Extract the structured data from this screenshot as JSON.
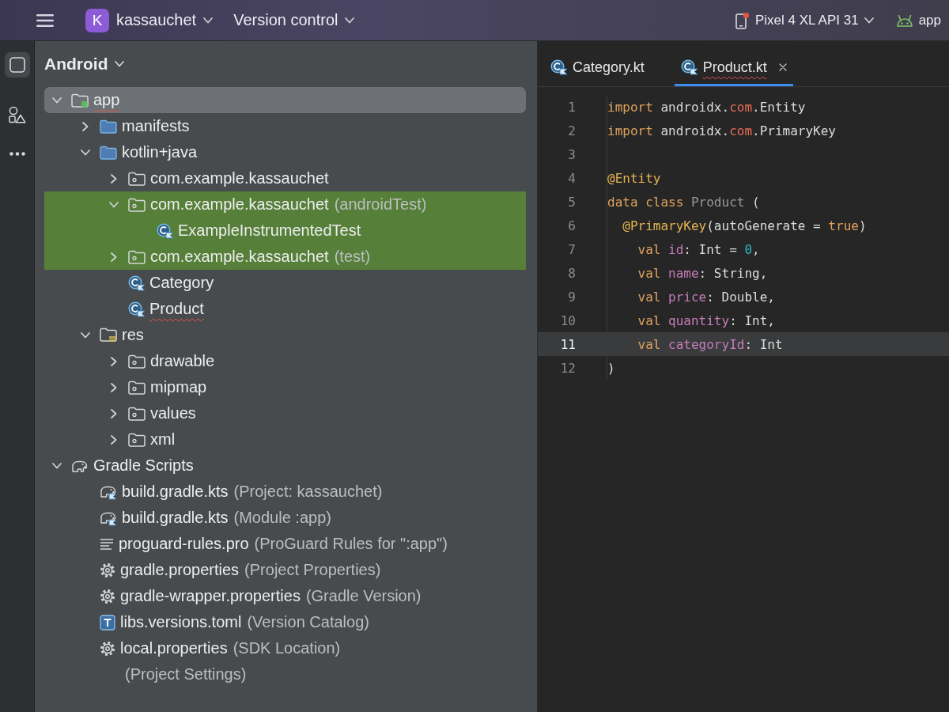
{
  "title_bar": {
    "project_badge": "K",
    "project": "kassauchet",
    "vcs": "Version control",
    "device": "Pixel 4 XL API 31",
    "run_config": "app"
  },
  "project_panel": {
    "view": "Android",
    "tree": [
      {
        "label": "app",
        "kind": "module",
        "expanded": true,
        "selected": true,
        "test": false,
        "error": true,
        "children": [
          {
            "label": "manifests",
            "kind": "folder",
            "expanded": false,
            "selected": false,
            "test": false,
            "error": false
          },
          {
            "label": "kotlin+java",
            "kind": "folder",
            "expanded": true,
            "selected": false,
            "test": false,
            "error": false,
            "children": [
              {
                "label": "com.example.kassauchet",
                "kind": "package",
                "expanded": false,
                "selected": false,
                "test": false,
                "error": false
              },
              {
                "label": "com.example.kassauchet",
                "hint": "(androidTest)",
                "kind": "package",
                "expanded": true,
                "selected": false,
                "test": true,
                "error": false,
                "children": [
                  {
                    "label": "ExampleInstrumentedTest",
                    "kind": "kotlin-class",
                    "selected": false,
                    "test": true,
                    "error": false
                  }
                ]
              },
              {
                "label": "com.example.kassauchet",
                "hint": "(test)",
                "kind": "package",
                "expanded": false,
                "selected": false,
                "test": true,
                "error": false
              },
              {
                "label": "Category",
                "kind": "kotlin-class",
                "selected": false,
                "test": false,
                "error": false
              },
              {
                "label": "Product",
                "kind": "kotlin-class",
                "selected": false,
                "test": false,
                "error": true
              }
            ]
          },
          {
            "label": "res",
            "kind": "res-folder",
            "expanded": true,
            "selected": false,
            "test": false,
            "error": false,
            "children": [
              {
                "label": "drawable",
                "kind": "directory",
                "expanded": false,
                "selected": false,
                "test": false,
                "error": false
              },
              {
                "label": "mipmap",
                "kind": "directory",
                "expanded": false,
                "selected": false,
                "test": false,
                "error": false
              },
              {
                "label": "values",
                "kind": "directory",
                "expanded": false,
                "selected": false,
                "test": false,
                "error": false
              },
              {
                "label": "xml",
                "kind": "directory",
                "expanded": false,
                "selected": false,
                "test": false,
                "error": false
              }
            ]
          }
        ]
      },
      {
        "label": "Gradle Scripts",
        "kind": "gradle",
        "expanded": true,
        "selected": false,
        "test": false,
        "error": false,
        "children": [
          {
            "label": "build.gradle.kts",
            "hint": "(Project: kassauchet)",
            "kind": "gradle-script",
            "selected": false,
            "test": false,
            "error": false
          },
          {
            "label": "build.gradle.kts",
            "hint": "(Module :app)",
            "kind": "gradle-script",
            "selected": false,
            "test": false,
            "error": false
          },
          {
            "label": "proguard-rules.pro",
            "hint": "(ProGuard Rules for \":app\")",
            "kind": "text",
            "selected": false,
            "test": false,
            "error": false
          },
          {
            "label": "gradle.properties",
            "hint": "(Project Properties)",
            "kind": "properties",
            "selected": false,
            "test": false,
            "error": false
          },
          {
            "label": "gradle-wrapper.properties",
            "hint": "(Gradle Version)",
            "kind": "properties",
            "selected": false,
            "test": false,
            "error": false
          },
          {
            "label": "libs.versions.toml",
            "hint": "(Version Catalog)",
            "kind": "toml",
            "selected": false,
            "test": false,
            "error": false
          },
          {
            "label": "local.properties",
            "hint": "(SDK Location)",
            "kind": "properties",
            "selected": false,
            "test": false,
            "error": false
          },
          {
            "hint": "(Project Settings)",
            "selected": false,
            "test": false
          }
        ]
      }
    ]
  },
  "editor": {
    "tabs": [
      {
        "label": "Category.kt",
        "selected": false,
        "error": false
      },
      {
        "label": "Product.kt",
        "selected": true,
        "error": true
      }
    ],
    "lines": [
      {
        "number": "1",
        "current": false,
        "tokens": [
          {
            "kind": "keyword",
            "text": "import"
          },
          {
            "kind": "plain",
            "text": " androidx."
          },
          {
            "kind": "error",
            "text": "com"
          },
          {
            "kind": "plain",
            "text": ".Entity"
          }
        ]
      },
      {
        "number": "2",
        "current": false,
        "tokens": [
          {
            "kind": "keyword",
            "text": "import"
          },
          {
            "kind": "plain",
            "text": " androidx."
          },
          {
            "kind": "error",
            "text": "com"
          },
          {
            "kind": "plain",
            "text": ".PrimaryKey"
          }
        ]
      },
      {
        "number": "3",
        "current": false
      },
      {
        "number": "4",
        "current": false,
        "tokens": [
          {
            "kind": "annotation",
            "text": "@Entity"
          }
        ]
      },
      {
        "number": "5",
        "current": false,
        "tokens": [
          {
            "kind": "keyword",
            "text": "data class"
          },
          {
            "kind": "unused",
            "text": " Product"
          },
          {
            "kind": "plain",
            "text": " ("
          }
        ]
      },
      {
        "number": "6",
        "current": false,
        "tokens": [
          {
            "kind": "annotation",
            "text": "  @PrimaryKey"
          },
          {
            "kind": "plain",
            "text": "(autoGenerate = "
          },
          {
            "kind": "keyword",
            "text": "true"
          },
          {
            "kind": "plain",
            "text": ")"
          }
        ]
      },
      {
        "number": "7",
        "current": false,
        "tokens": [
          {
            "kind": "keyword",
            "text": "    val "
          },
          {
            "kind": "property",
            "text": "id"
          },
          {
            "kind": "plain",
            "text": ": Int = "
          },
          {
            "kind": "number",
            "text": "0"
          },
          {
            "kind": "plain",
            "text": ","
          }
        ]
      },
      {
        "number": "8",
        "current": false,
        "tokens": [
          {
            "kind": "keyword",
            "text": "    val "
          },
          {
            "kind": "property",
            "text": "name"
          },
          {
            "kind": "plain",
            "text": ": String,"
          }
        ]
      },
      {
        "number": "9",
        "current": false,
        "tokens": [
          {
            "kind": "keyword",
            "text": "    val "
          },
          {
            "kind": "property",
            "text": "price"
          },
          {
            "kind": "plain",
            "text": ": Double,"
          }
        ]
      },
      {
        "number": "10",
        "current": false,
        "tokens": [
          {
            "kind": "keyword",
            "text": "    val "
          },
          {
            "kind": "property",
            "text": "quantity"
          },
          {
            "kind": "plain",
            "text": ": Int,"
          }
        ]
      },
      {
        "number": "11",
        "current": true,
        "tokens": [
          {
            "kind": "keyword",
            "text": "    val "
          },
          {
            "kind": "property",
            "text": "categoryId"
          },
          {
            "kind": "plain",
            "text": ": Int"
          }
        ]
      },
      {
        "number": "12",
        "current": false,
        "tokens": [
          {
            "kind": "plain",
            "text": ")"
          }
        ]
      }
    ]
  }
}
